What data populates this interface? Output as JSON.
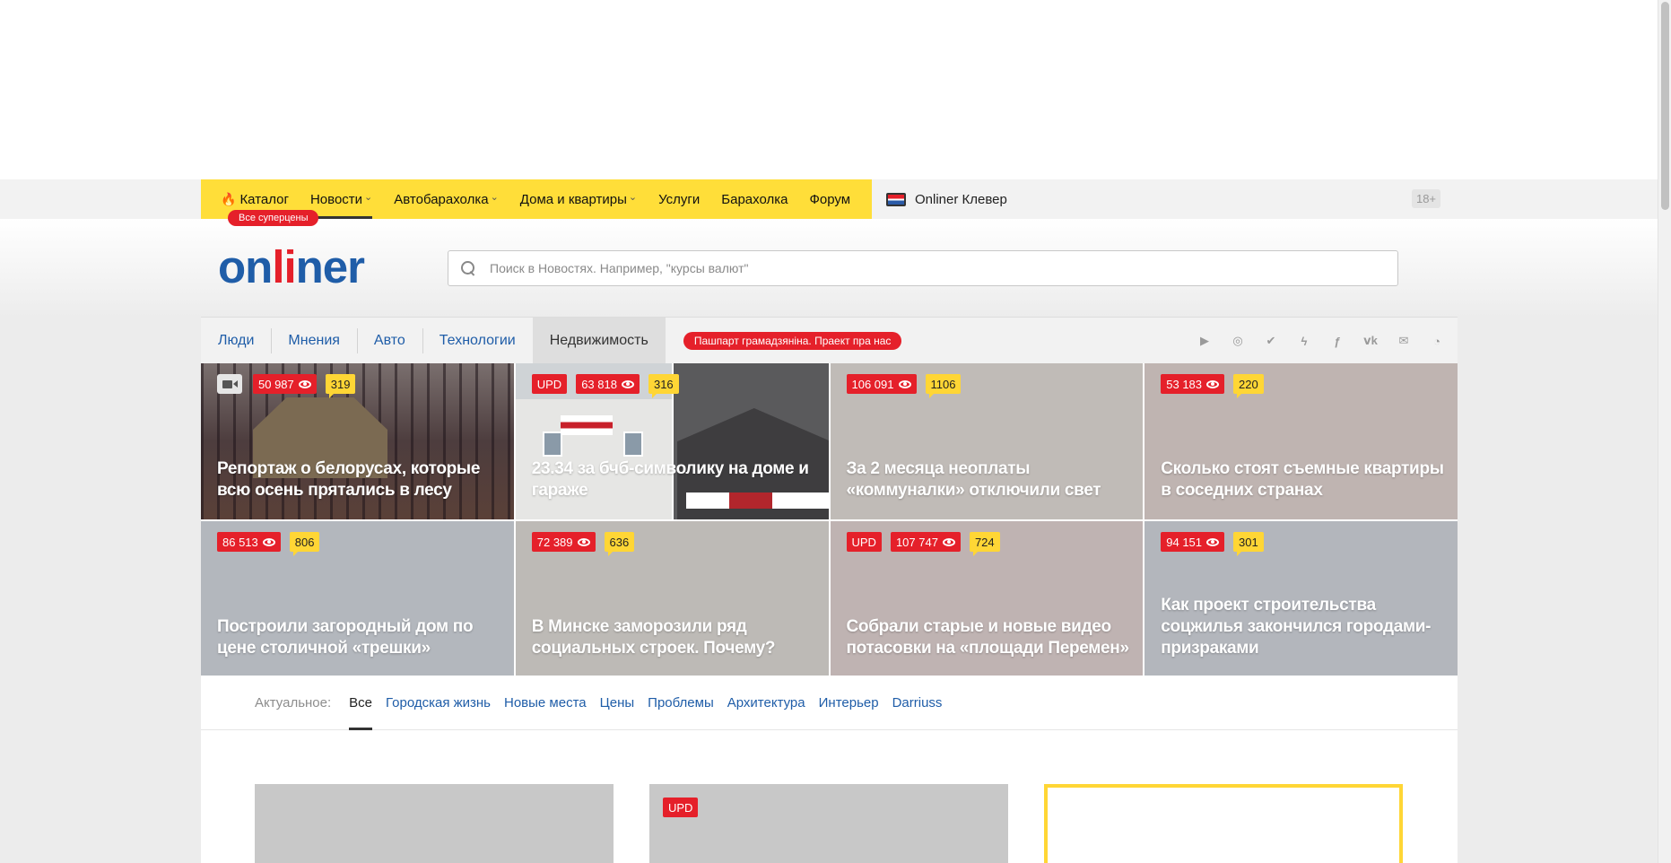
{
  "topnav": {
    "catalog": "Каталог",
    "items": [
      {
        "label": "Новости"
      },
      {
        "label": "Автобарахолка"
      },
      {
        "label": "Дома и квартиры"
      },
      {
        "label": "Услуги"
      },
      {
        "label": "Барахолка"
      },
      {
        "label": "Форум"
      }
    ],
    "superprice_badge": "Все суперцены",
    "clever": "Onliner Клевер",
    "age": "18+"
  },
  "header": {
    "logo_part1": "on",
    "logo_accent": "li",
    "logo_part2": "ner",
    "search_placeholder": "Поиск в Новостях. Например, \"курсы валют\""
  },
  "sections": {
    "items": [
      {
        "label": "Люди"
      },
      {
        "label": "Мнения"
      },
      {
        "label": "Авто"
      },
      {
        "label": "Технологии"
      },
      {
        "label": "Недвижимость"
      }
    ],
    "promo": "Пашпарт грамадзяніна. Праект пра нас",
    "socials": [
      "youtube-icon",
      "instagram-icon",
      "twitter-icon",
      "odnoklassniki-icon",
      "facebook-icon",
      "vk-icon",
      "mail-icon",
      "rss-icon"
    ]
  },
  "news": [
    {
      "title": "Репортаж о белорусах, которые всю осень прятались в лесу",
      "views": "50 987",
      "comments": "319",
      "video": true,
      "upd": false,
      "bg": "photo-tent"
    },
    {
      "title": "23.34 за бчб-символику на доме и гараже",
      "views": "63 818",
      "comments": "316",
      "video": false,
      "upd": true,
      "bg": "photo-house"
    },
    {
      "title": "За 2 месяца неоплаты «коммуналки» отключили свет",
      "views": "106 091",
      "comments": "1106",
      "video": false,
      "upd": false,
      "bg": "#c0bbb7"
    },
    {
      "title": "Сколько стоят съемные квартиры в соседних странах",
      "views": "53 183",
      "comments": "220",
      "video": false,
      "upd": false,
      "bg": "#bfb4b1"
    },
    {
      "title": "Построили загородный дом по цене столичной «трешки»",
      "views": "86 513",
      "comments": "806",
      "video": false,
      "upd": false,
      "bg": "#b3b7bd"
    },
    {
      "title": "В Минске заморозили ряд социальных строек. Почему?",
      "views": "72 389",
      "comments": "636",
      "video": false,
      "upd": false,
      "bg": "#bdbab6"
    },
    {
      "title": "Собрали старые и новые видео потасовки на «площади Перемен»",
      "views": "107 747",
      "comments": "724",
      "video": false,
      "upd": true,
      "bg": "#bfb3b2"
    },
    {
      "title": "Как проект строительства соцжилья закончился городами-призраками",
      "views": "94 151",
      "comments": "301",
      "video": false,
      "upd": false,
      "bg": "#b3b6bc"
    }
  ],
  "upd_label": "UPD",
  "tags": {
    "label": "Актуальное:",
    "items": [
      {
        "label": "Все"
      },
      {
        "label": "Городская жизнь"
      },
      {
        "label": "Новые места"
      },
      {
        "label": "Цены"
      },
      {
        "label": "Проблемы"
      },
      {
        "label": "Архитектура"
      },
      {
        "label": "Интерьер"
      },
      {
        "label": "Darriuss"
      }
    ]
  },
  "colors": {
    "brand_blue": "#1f5da8",
    "brand_red": "#e5202a",
    "yellow": "#ffde39"
  }
}
